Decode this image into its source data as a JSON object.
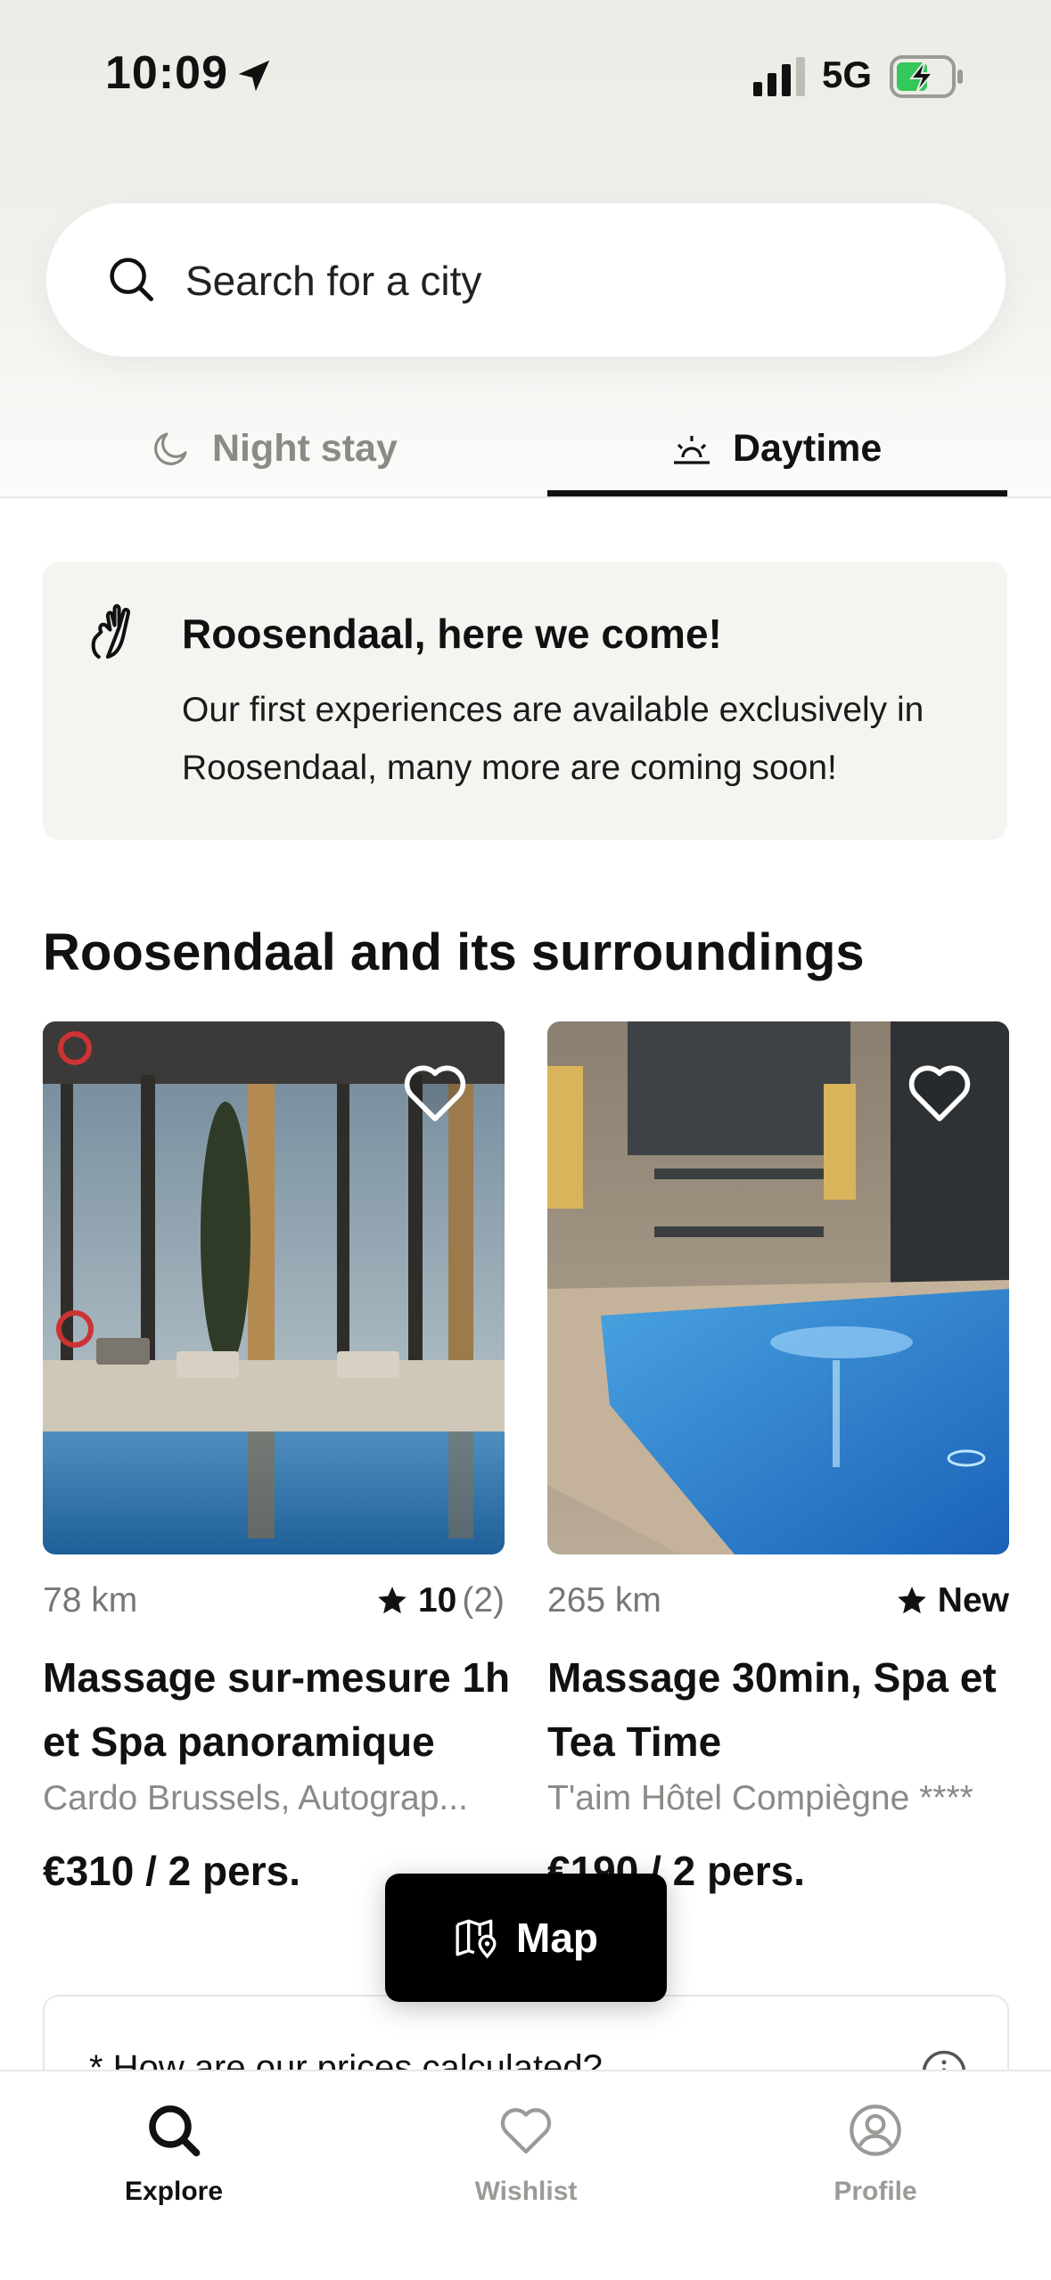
{
  "status_bar": {
    "time": "10:09",
    "network": "5G"
  },
  "search": {
    "placeholder": "Search for a city"
  },
  "tabs": [
    {
      "label": "Night stay",
      "icon": "moon-icon",
      "selected": false
    },
    {
      "label": "Daytime",
      "icon": "sunrise-icon",
      "selected": true
    }
  ],
  "info_banner": {
    "title": "Roosendaal, here we come!",
    "text": "Our first experiences are available exclusively in Roosendaal, many more are coming soon!"
  },
  "section": {
    "title": "Roosendaal and its surroundings"
  },
  "cards": [
    {
      "distance": "78 km",
      "rating_score": "10",
      "rating_count": "(2)",
      "title": "Massage sur-mesure 1h et Spa panoramique",
      "subtitle": "Cardo Brussels, Autograp...",
      "price": "€310 / 2 pers."
    },
    {
      "distance": "265 km",
      "rating_score": "New",
      "rating_count": "",
      "title": "Massage 30min, Spa et Tea Time",
      "subtitle": "T'aim Hôtel Compiègne ****",
      "price": "€190 / 2 pers."
    }
  ],
  "map_button": {
    "label": "Map"
  },
  "teaser": {
    "text": "* How are our prices calculated?"
  },
  "tabbar": [
    {
      "label": "Explore",
      "icon": "search-icon",
      "active": true
    },
    {
      "label": "Wishlist",
      "icon": "heart-icon",
      "active": false
    },
    {
      "label": "Profile",
      "icon": "profile-icon",
      "active": false
    }
  ],
  "colors": {
    "accent": "#111111",
    "muted": "#8a8a86",
    "battery": "#34c759"
  }
}
